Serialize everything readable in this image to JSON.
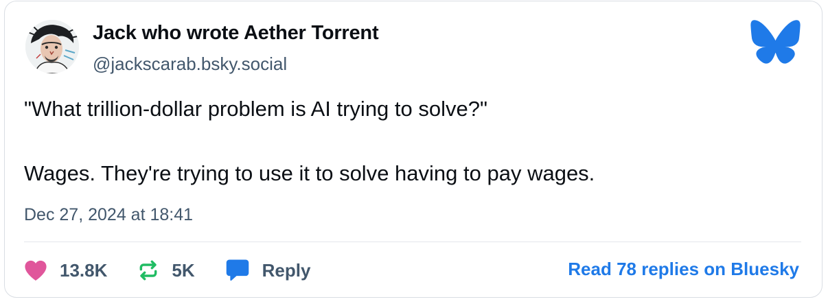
{
  "author": {
    "display_name": "Jack who wrote Aether Torrent",
    "handle": "@jackscarab.bsky.social",
    "avatar_icon": "sketch-portrait-avatar"
  },
  "post": {
    "lines": [
      "\"What trillion-dollar problem is AI trying to solve?\"",
      "Wages. They're trying to use it to solve having to pay wages."
    ],
    "timestamp": "Dec 27, 2024 at 18:41"
  },
  "actions": {
    "likes": {
      "count": "13.8K",
      "icon": "heart-icon",
      "color": "#e0569b"
    },
    "reposts": {
      "count": "5K",
      "icon": "repost-icon",
      "color": "#20bc63"
    },
    "reply": {
      "label": "Reply",
      "icon": "reply-bubble-icon",
      "color": "#1f7ae8"
    }
  },
  "read_replies_label": "Read 78 replies on Bluesky",
  "brand": {
    "logo": "bluesky-butterfly-icon",
    "accent": "#1f7ae8"
  }
}
